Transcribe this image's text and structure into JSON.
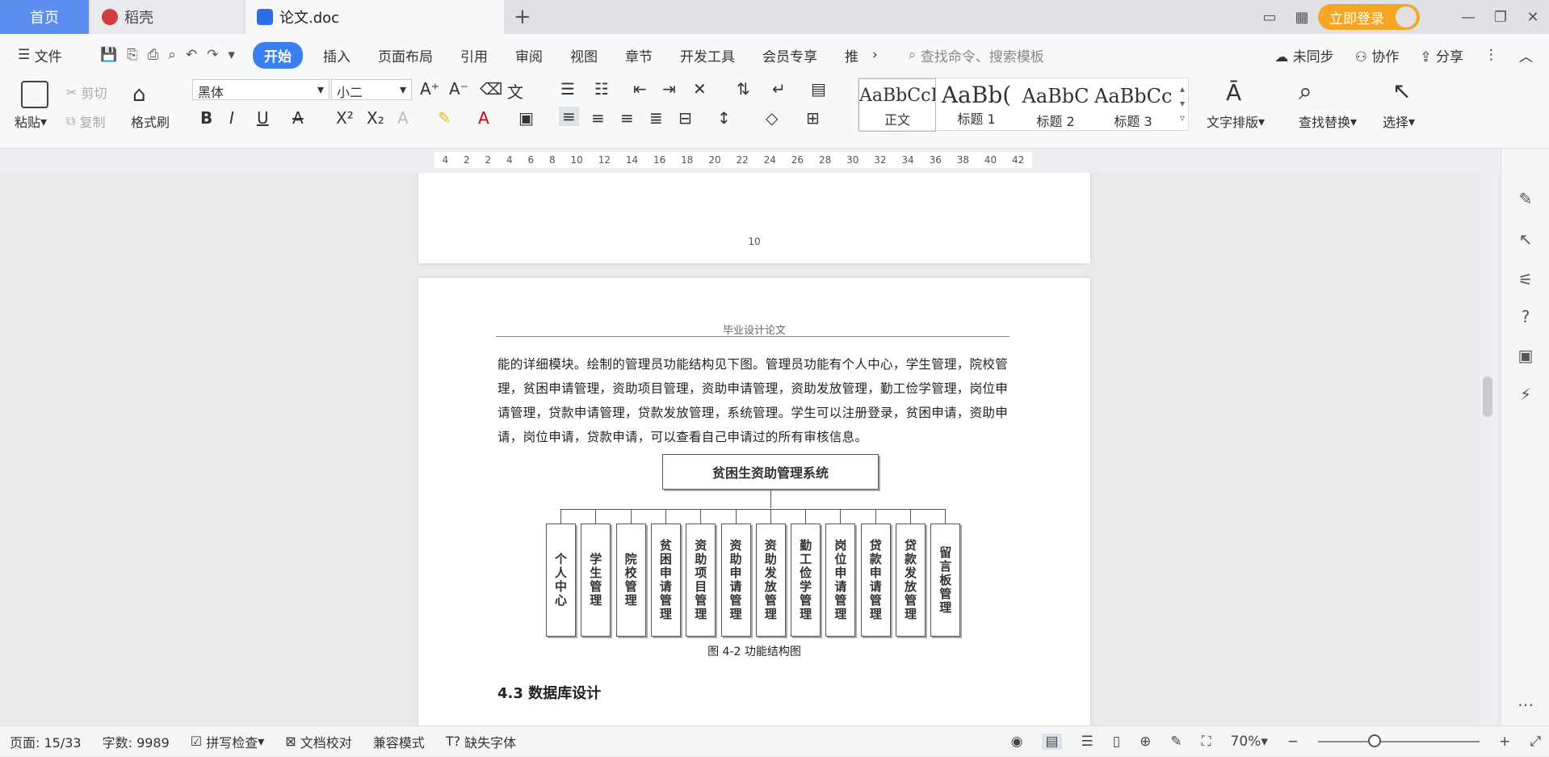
{
  "titlebar": {
    "tabs": [
      {
        "label": "首页"
      },
      {
        "label": "稻壳"
      },
      {
        "label": "论文.doc"
      }
    ],
    "login_label": "立即登录"
  },
  "menubar": {
    "file_label": "文件",
    "tabs": [
      "开始",
      "插入",
      "页面布局",
      "引用",
      "审阅",
      "视图",
      "章节",
      "开发工具",
      "会员专享",
      "推"
    ],
    "search_placeholder": "查找命令、搜索模板",
    "right": [
      "未同步",
      "协作",
      "分享"
    ]
  },
  "ribbon": {
    "paste": "粘贴",
    "cut": "剪切",
    "copy": "复制",
    "format_painter": "格式刷",
    "font_name": "黑体",
    "font_size": "小二",
    "styles": [
      {
        "preview": "AaBbCcI",
        "label": "正文"
      },
      {
        "preview": "AaBb(",
        "label": "标题 1"
      },
      {
        "preview": "AaBbC",
        "label": "标题 2"
      },
      {
        "preview": "AaBbCc",
        "label": "标题 3"
      }
    ],
    "text_layout": "文字排版",
    "find_replace": "查找替换",
    "select": "选择"
  },
  "ruler": [
    "4",
    "2",
    "2",
    "4",
    "6",
    "8",
    "10",
    "12",
    "14",
    "16",
    "18",
    "20",
    "22",
    "24",
    "26",
    "28",
    "30",
    "32",
    "34",
    "36",
    "38",
    "40",
    "42"
  ],
  "document": {
    "page_number": "10",
    "header": "毕业设计论文",
    "paragraph": "能的详细模块。绘制的管理员功能结构见下图。管理员功能有个人中心，学生管理，院校管理，贫困申请管理，资助项目管理，资助申请管理，资助发放管理，勤工俭学管理，岗位申请管理，贷款申请管理，贷款发放管理，系统管理。学生可以注册登录，贫困申请，资助申请，岗位申请，贷款申请，可以查看自己申请过的所有审核信息。",
    "chart_root": "贫困生资助管理系统",
    "modules": [
      "个人中心",
      "学生管理",
      "院校管理",
      "贫困申请管理",
      "资助项目管理",
      "资助申请管理",
      "资助发放管理",
      "勤工俭学管理",
      "岗位申请管理",
      "贷款申请管理",
      "贷款发放管理",
      "留言板管理"
    ],
    "figure_caption": "图 4-2  功能结构图",
    "section_heading": "4.3  数据库设计"
  },
  "statusbar": {
    "page": "页面: 15/33",
    "words": "字数: 9989",
    "spell": "拼写检查",
    "proof": "文档校对",
    "compat": "兼容模式",
    "missing_font": "缺失字体",
    "zoom": "70%"
  }
}
